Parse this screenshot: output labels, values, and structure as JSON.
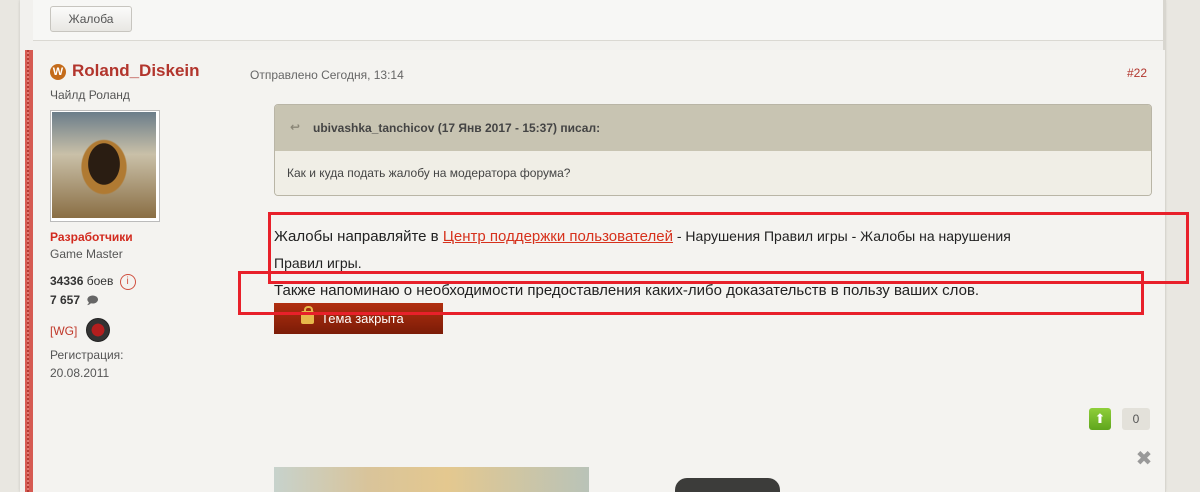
{
  "prev_post": {
    "report_button": "Жалоба"
  },
  "post": {
    "author": {
      "name": "Roland_Diskein",
      "title": "Чайлд Роланд",
      "group": "Разработчики",
      "rank": "Game Master",
      "battles_count": "34336",
      "battles_label": "боев",
      "posts_count": "7 657",
      "clan_tag": "[WG]",
      "registration_label": "Регистрация:",
      "registration_date": "20.08.2011"
    },
    "date": "Отправлено Сегодня, 13:14",
    "number": "#22",
    "quote": {
      "header": "ubivashka_tanchicov (17 Янв 2017 - 15:37) писал:",
      "body": "Как и куда подать жалобу на модератора форума?"
    },
    "message": {
      "line1_prefix": "Жалобы направляйте в ",
      "line1_link": "Центр поддержки пользователей",
      "line1_tail": " - Нарушения Правил игры - Жалобы на нарушения",
      "line2": "Правил игры.",
      "line3": "Также напоминаю о необходимости предоставления каких-либо доказательств в пользу ваших слов."
    },
    "closed_button": "Тема закрыта",
    "vote_count": "0"
  },
  "colors": {
    "author_name": "#b2352d",
    "group": "#d22a1e",
    "link": "#d6311c",
    "highlight_box": "#e8202a",
    "vote_up": "#6fb52a"
  }
}
